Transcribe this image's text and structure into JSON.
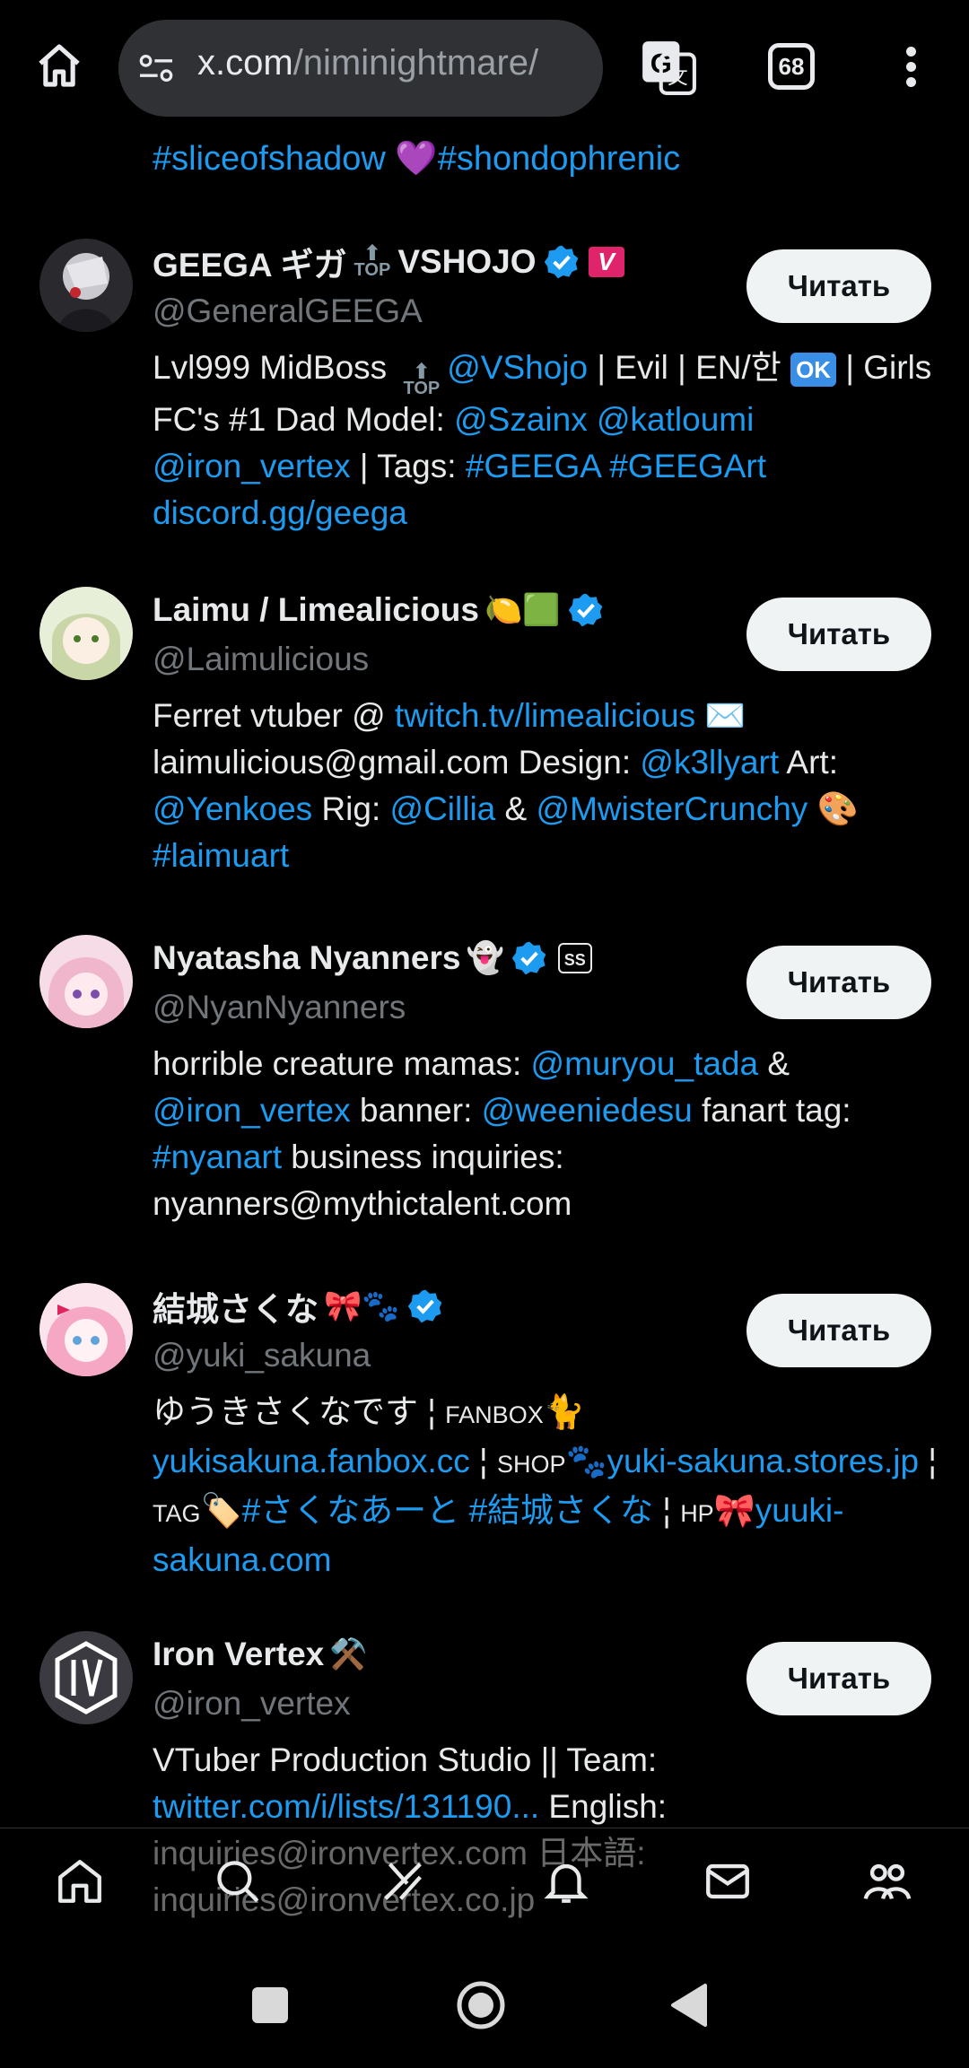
{
  "browser": {
    "url_host": "x.com",
    "url_path": "/niminightmare/",
    "tab_count": "68"
  },
  "top_tags": {
    "tag1": "#sliceofshadow",
    "heart": "💜",
    "tag2": "#shondophrenic"
  },
  "follow_label": "Читать",
  "users": [
    {
      "name_a": "GEEGA ギガ",
      "name_b": "VSHOJO",
      "top_badge": "TOP",
      "v_badge": "V",
      "handle": "@GeneralGEEGA",
      "bio": {
        "t1": "Lvl999 MidBoss ",
        "top": "TOP",
        "l1": "@VShojo",
        "t2": " | Evil | EN/한 ",
        "ok": "OK",
        "t3": " | Girls FC's #1 Dad Model: ",
        "l2": "@Szainx",
        "t4": " ",
        "l3": "@katloumi",
        "t5": " ",
        "l4": "@iron_vertex",
        "t6": " | Tags: ",
        "l5": "#GEEGA",
        "t7": " ",
        "l6": "#GEEGArt",
        "t8": " ",
        "l7": "discord.gg/geega"
      }
    },
    {
      "name": "Laimu / Limealicious",
      "emoji": "🍋🟩",
      "handle": "@Laimulicious",
      "bio": {
        "t1": "Ferret vtuber @ ",
        "l1": "twitch.tv/limealicious",
        "e1": " ✉️ ",
        "t2": "laimulicious@gmail.com Design: ",
        "l2": "@k3llyart",
        "t3": " Art: ",
        "l3": "@Yenkoes",
        "t4": " Rig: ",
        "l4": "@Cillia",
        "t5": " & ",
        "l5": "@MwisterCrunchy",
        "e2": " 🎨 ",
        "l6": "#laimuart"
      }
    },
    {
      "name": "Nyatasha Nyanners",
      "emoji": "👻",
      "ss_badge": "SS",
      "handle": "@NyanNyanners",
      "bio": {
        "t1": "horrible creature mamas: ",
        "l1": "@muryou_tada",
        "t2": " & ",
        "l2": "@iron_vertex",
        "t3": " banner: ",
        "l3": "@weeniedesu",
        "t4": " fanart tag: ",
        "l4": "#nyanart",
        "t5": " business inquiries: nyanners@mythictalent.com"
      }
    },
    {
      "name": "結城さくな",
      "emoji": "🎀🐾",
      "handle": "@yuki_sakuna",
      "bio": {
        "t1": "ゆうきさくなです ¦ ",
        "s1": "FANBOX",
        "e1": "🐈",
        "l1": "yukisakuna.fanbox.cc",
        "t2": " ¦ ",
        "s2": "SHOP",
        "e2": "🐾",
        "l2": "yuki-sakuna.stores.jp",
        "t3": " ¦ ",
        "s3": "TAG",
        "e3": "🏷️",
        "l3": "#さくなあーと",
        "t4": " ",
        "l4": "#結城さくな",
        "t5": " ¦ ",
        "s4": "HP",
        "e4": "🎀",
        "l5": "yuuki-sakuna.com"
      }
    },
    {
      "name": "Iron Vertex",
      "emoji": "⚒️",
      "handle": "@iron_vertex",
      "bio": {
        "t1": "VTuber Production Studio || Team: ",
        "l1": "twitter.com/i/lists/131190...",
        "t2": " English: inquiries@ironvertex.com 日本語: inquiries@ironvertex.co.jp"
      }
    }
  ]
}
